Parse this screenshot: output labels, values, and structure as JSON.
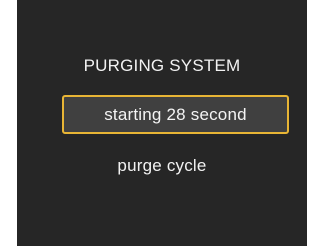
{
  "screen": {
    "title": "PURGING SYSTEM",
    "status": "starting 28 second",
    "cycle_label": "purge cycle"
  },
  "colors": {
    "screen_bg": "#262626",
    "status_bg": "#404040",
    "status_border": "#e8b535",
    "text": "#f2f2f2"
  }
}
